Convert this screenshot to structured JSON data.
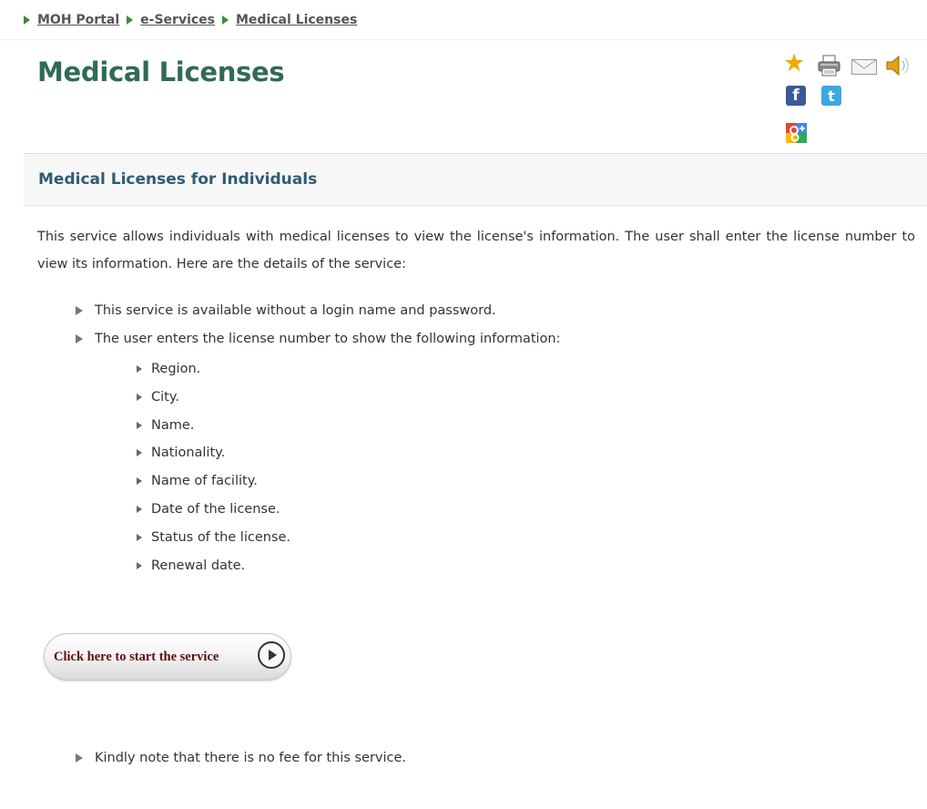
{
  "breadcrumb": {
    "items": [
      "MOH Portal",
      "e-Services",
      "Medical Licenses"
    ]
  },
  "page": {
    "title": "Medical Licenses"
  },
  "tools": {
    "icons": [
      "star-icon",
      "printer-icon",
      "mail-icon",
      "speaker-icon",
      "facebook-icon",
      "twitter-icon",
      "google-plus-icon"
    ],
    "facebook_glyph": "f",
    "twitter_glyph": "t"
  },
  "section": {
    "title": "Medical Licenses for Individuals",
    "intro": "This service allows individuals with medical licenses to view the license's information. The user shall enter the license number to view its information. Here are the details of the service:"
  },
  "details": {
    "items": [
      "This service is available without a login name and password.",
      "The user enters the license number to show the following information:"
    ],
    "info_fields": [
      "Region.",
      "City.",
      "Name.",
      "Nationality.",
      "Name of facility.",
      "Date of the license.",
      "Status of the license.",
      "Renewal date."
    ]
  },
  "service_button": {
    "label": "Click here to start the service"
  },
  "fee_note": "Kindly note that there is no fee for this service.",
  "colors": {
    "title_green": "#2f6b57",
    "section_blue": "#2e5c75",
    "breadcrumb_arrow": "#3f8a3a",
    "button_text": "#5a1010"
  }
}
